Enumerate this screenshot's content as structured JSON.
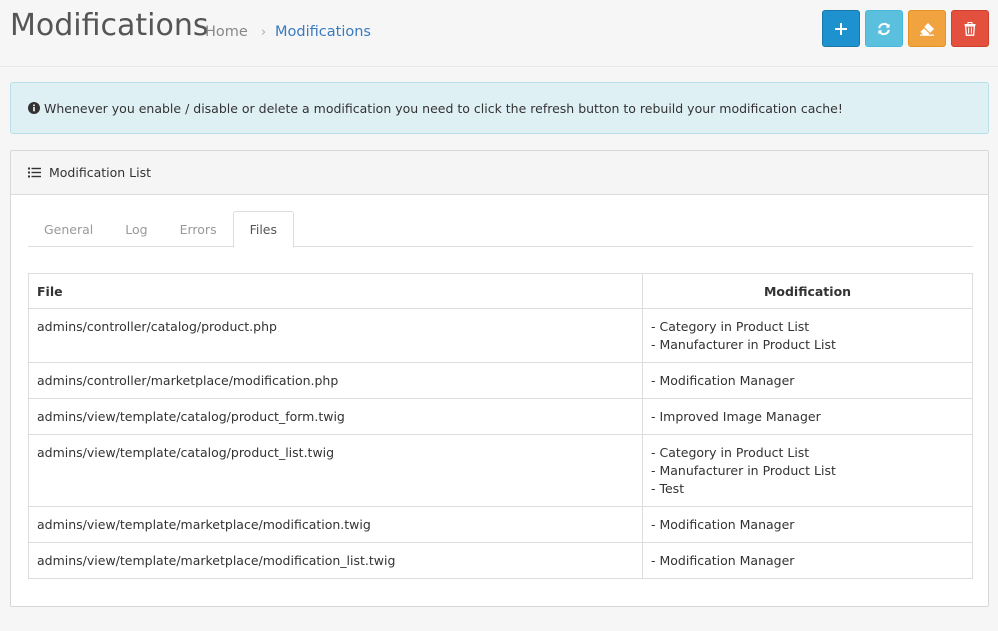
{
  "header": {
    "title": "Modifications",
    "breadcrumb": {
      "home": "Home",
      "separator": "›",
      "current": "Modifications"
    },
    "actions": [
      {
        "name": "add",
        "icon": "plus-icon",
        "color": "#1e91cf"
      },
      {
        "name": "refresh",
        "icon": "refresh-icon",
        "color": "#5bc0de"
      },
      {
        "name": "clear",
        "icon": "eraser-icon",
        "color": "#f0a33e"
      },
      {
        "name": "delete",
        "icon": "trash-icon",
        "color": "#e3503e"
      }
    ]
  },
  "alert": {
    "icon": "info-circle-icon",
    "text": "Whenever you enable / disable or delete a modification you need to click the refresh button to rebuild your modification cache!"
  },
  "panel": {
    "icon": "list-icon",
    "title": "Modification List",
    "tabs": [
      "General",
      "Log",
      "Errors",
      "Files"
    ],
    "active_tab": "Files",
    "table": {
      "columns": [
        "File",
        "Modification"
      ],
      "rows": [
        {
          "file": "admins/controller/catalog/product.php",
          "mods": [
            "- Category in Product List",
            "- Manufacturer in Product List"
          ]
        },
        {
          "file": "admins/controller/marketplace/modification.php",
          "mods": [
            "- Modification Manager"
          ]
        },
        {
          "file": "admins/view/template/catalog/product_form.twig",
          "mods": [
            "- Improved Image Manager"
          ]
        },
        {
          "file": "admins/view/template/catalog/product_list.twig",
          "mods": [
            "- Category in Product List",
            "- Manufacturer in Product List",
            "- Test"
          ]
        },
        {
          "file": "admins/view/template/marketplace/modification.twig",
          "mods": [
            "- Modification Manager"
          ]
        },
        {
          "file": "admins/view/template/marketplace/modification_list.twig",
          "mods": [
            "- Modification Manager"
          ]
        }
      ]
    }
  }
}
